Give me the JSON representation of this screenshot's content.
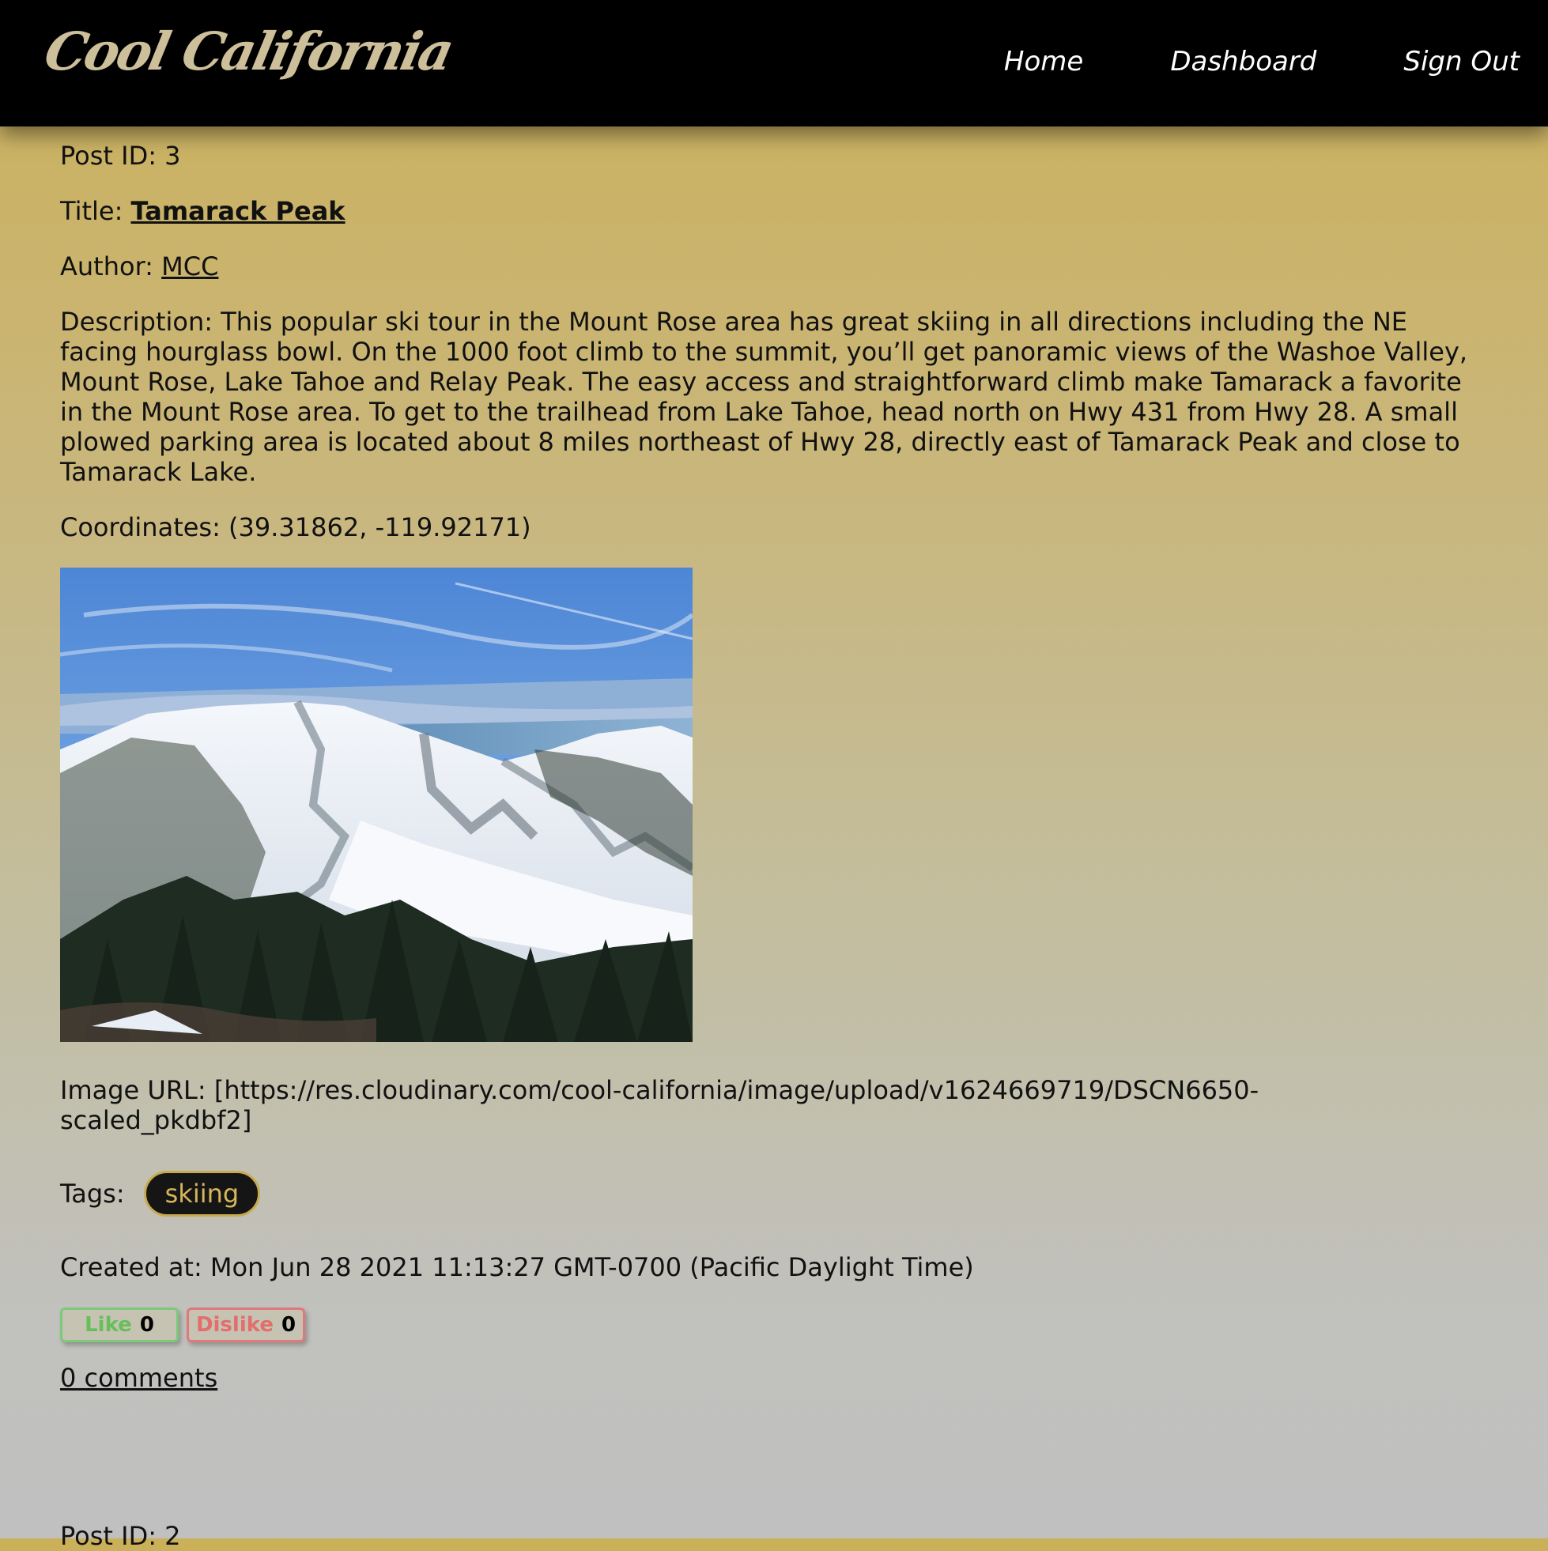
{
  "nav": {
    "brand": "Cool California",
    "links": [
      "Home",
      "Dashboard",
      "Sign Out"
    ]
  },
  "post": {
    "id_label": "Post ID:",
    "id": "3",
    "title_label": "Title:",
    "title": "Tamarack Peak",
    "author_label": "Author:",
    "author": "MCC",
    "description_label": "Description:",
    "description": "This popular ski tour in the Mount Rose area has great skiing in all directions including the NE facing hourglass bowl. On the 1000 foot climb to the summit, you’ll get panoramic views of the Washoe Valley, Mount Rose, Lake Tahoe and Relay Peak. The easy access and straightforward climb make Tamarack a favorite in the Mount Rose area. To get to the trailhead from Lake Tahoe, head north on Hwy 431 from Hwy 28. A small plowed parking area is located about 8 miles northeast of Hwy 28, directly east of Tamarack Peak and close to Tamarack Lake.",
    "coordinates_label": "Coordinates:",
    "coordinates": "(39.31862, -119.92171)",
    "image_url_label": "Image URL:",
    "image_url": "[https://res.cloudinary.com/cool-california/image/upload/v1624669719/DSCN6650-scaled_pkdbf2]",
    "tags_label": "Tags:",
    "tags": [
      "skiing"
    ],
    "created_label": "Created at:",
    "created_at": "Mon Jun 28 2021 11:13:27 GMT-0700 (Pacific Daylight Time)",
    "like_label": "Like",
    "like_count": "0",
    "dislike_label": "Dislike",
    "dislike_count": "0",
    "comments_link": "0 comments"
  },
  "next_post": {
    "id_label": "Post ID:",
    "id": "2"
  },
  "colors": {
    "navbar": "#000000",
    "brand": "#cdbf9a",
    "tag_bg": "#151515",
    "tag_text": "#d6b65a",
    "like": "#66c05a",
    "dislike": "#e36e6e"
  }
}
